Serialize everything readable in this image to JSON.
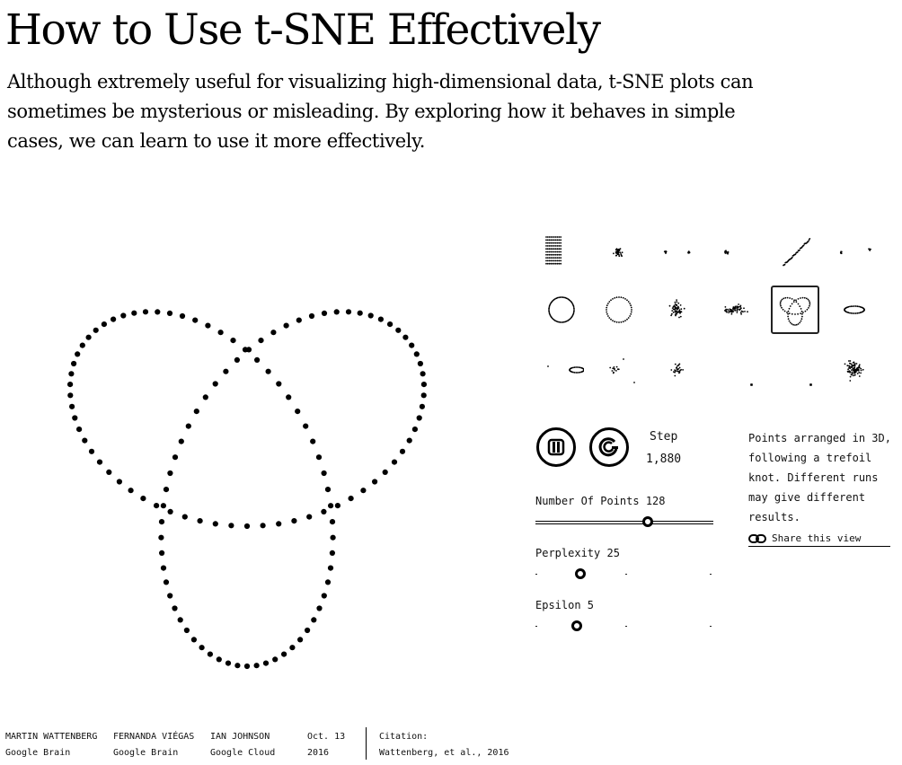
{
  "header": {
    "title": "How to Use t-SNE Effectively",
    "subtitle": "Although extremely useful for visualizing high-dimensional data, t-SNE plots can sometimes be mysterious or misleading. By exploring how it behaves in simple cases, we can learn to use it more effectively."
  },
  "dataset_thumbnails": [
    {
      "name": "grid"
    },
    {
      "name": "gaussian-cloud"
    },
    {
      "name": "two-clusters"
    },
    {
      "name": "three-clusters"
    },
    {
      "name": "long-line"
    },
    {
      "name": "random-walk"
    },
    {
      "name": "circle"
    },
    {
      "name": "circle-random"
    },
    {
      "name": "gaussian-3d"
    },
    {
      "name": "elongated-gaussian"
    },
    {
      "name": "trefoil-knot",
      "selected": true
    },
    {
      "name": "linked-rings"
    },
    {
      "name": "unlinked-rings"
    },
    {
      "name": "orthogonal-steps"
    },
    {
      "name": "random-jump"
    },
    {
      "name": "subset-clusters"
    },
    {
      "name": "uniform-small"
    },
    {
      "name": "nested-clusters"
    }
  ],
  "controls": {
    "pause_icon": "pause-icon",
    "restart_icon": "restart-icon",
    "step_label": "Step",
    "step_value": "1,880",
    "sliders": [
      {
        "key": "points",
        "label": "Number Of Points 128",
        "value": 128,
        "fraction": 0.63,
        "style": "line"
      },
      {
        "key": "perplexity",
        "label": "Perplexity 25",
        "value": 25,
        "fraction": 0.25,
        "style": "dots"
      },
      {
        "key": "epsilon",
        "label": "Epsilon 5",
        "value": 5,
        "fraction": 0.23,
        "style": "dots"
      }
    ]
  },
  "description": "Points arranged in 3D, following a trefoil knot. Different runs may give different results.",
  "share": {
    "icon": "link-icon",
    "label": "Share this view"
  },
  "footer": {
    "authors": [
      {
        "name": "MARTIN WATTENBERG",
        "affiliation": "Google Brain"
      },
      {
        "name": "FERNANDA VIÉGAS",
        "affiliation": "Google Brain"
      },
      {
        "name": "IAN JOHNSON",
        "affiliation": "Google Cloud"
      }
    ],
    "date_line1": "Oct. 13",
    "date_line2": "2016",
    "citation_label": "Citation:",
    "citation_value": "Wattenberg, et al., 2016"
  }
}
